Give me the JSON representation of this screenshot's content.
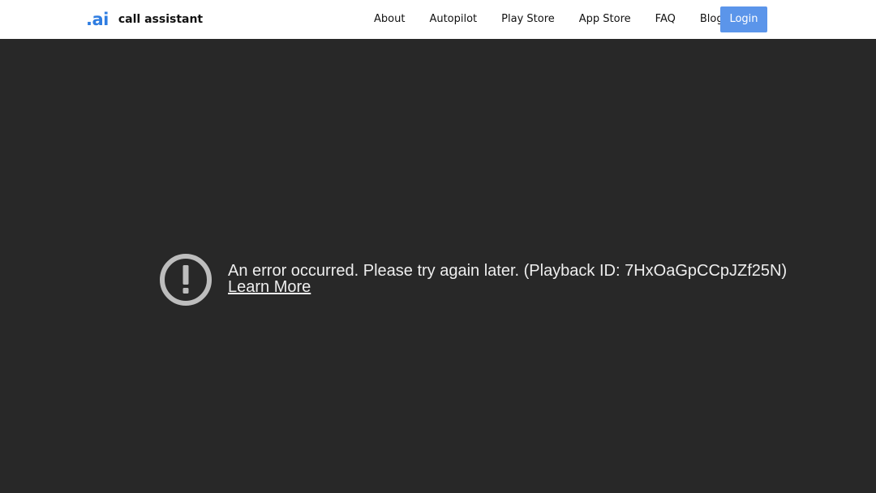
{
  "header": {
    "logo_mark_dot": ".",
    "logo_mark_ai": "ai",
    "logo_text": "call assistant",
    "nav": [
      {
        "label": "About"
      },
      {
        "label": "Autopilot"
      },
      {
        "label": "Play Store"
      },
      {
        "label": "App Store"
      },
      {
        "label": "FAQ"
      },
      {
        "label": "Blog"
      }
    ],
    "login_label": "Login"
  },
  "player": {
    "error_message": "An error occurred. Please try again later. (Playback ID: 7HxOaGpCCpJZf25N)",
    "learn_more_label": "Learn More",
    "icon": "error-exclamation-icon"
  },
  "colors": {
    "accent": "#5b95ea",
    "logo_blue": "#2f7de1",
    "player_background": "#282828",
    "error_text": "#eeeeee",
    "error_icon": "#bdbdbd"
  }
}
